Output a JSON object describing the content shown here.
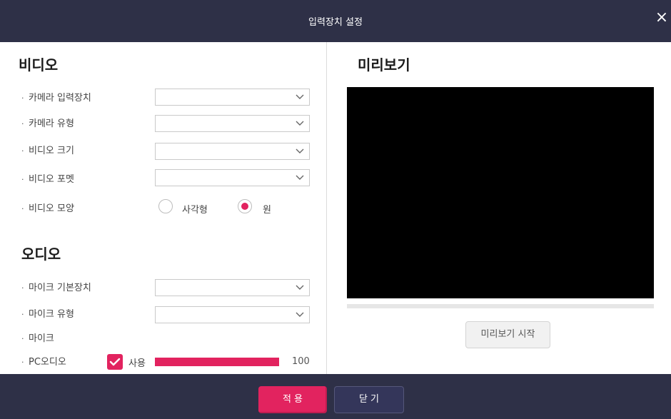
{
  "dialog": {
    "title": "입력장치 설정",
    "close_icon": "×"
  },
  "video": {
    "section_title": "비디오",
    "rows": [
      {
        "label": "카메라 입력장치",
        "value": ""
      },
      {
        "label": "카메라 유형",
        "value": ""
      },
      {
        "label": "비디오 크기",
        "value": ""
      },
      {
        "label": "비디오 포멧",
        "value": ""
      }
    ],
    "shape": {
      "label": "비디오 모양",
      "options": [
        {
          "label": "사각형",
          "selected": false
        },
        {
          "label": "원",
          "selected": true
        }
      ]
    }
  },
  "audio": {
    "section_title": "오디오",
    "rows": [
      {
        "label": "마이크 기본장치",
        "value": ""
      },
      {
        "label": "마이크 유형",
        "value": ""
      }
    ],
    "mic_label": "마이크",
    "pc_audio": {
      "label": "PC오디오",
      "enabled": true,
      "checkbox_label": "사용",
      "volume": 100,
      "volume_fraction": 1.0
    }
  },
  "preview": {
    "title": "미리보기",
    "start_button": "미리보기 시작"
  },
  "footer": {
    "apply": "적 용",
    "close": "닫 기"
  },
  "colors": {
    "accent": "#e2235f",
    "titlebar": "#2e3047",
    "preview_bg": "#000000"
  },
  "icons": {
    "bullet": "·",
    "close": "close-icon",
    "chevron": "chevron-down-icon",
    "check": "check-icon"
  }
}
